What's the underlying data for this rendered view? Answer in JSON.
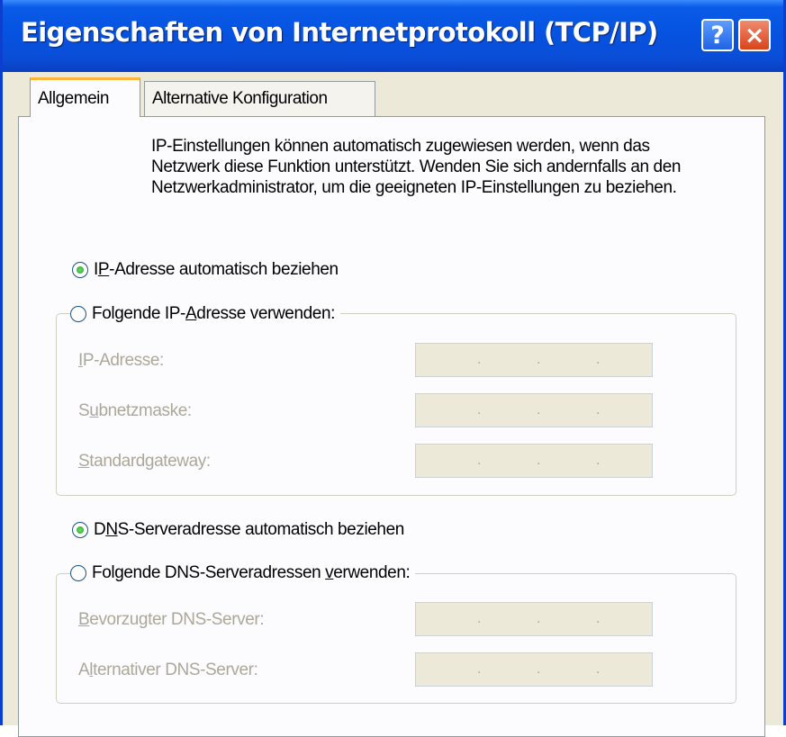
{
  "window": {
    "title": "Eigenschaften von Internetprotokoll (TCP/IP)",
    "help_label": "?",
    "close_label": "×"
  },
  "tabs": [
    {
      "label": "Allgemein",
      "active": true
    },
    {
      "label": "Alternative Konfiguration",
      "active": false
    }
  ],
  "description": "IP-Einstellungen können automatisch zugewiesen werden, wenn das Netzwerk diese Funktion unterstützt. Wenden Sie sich andernfalls an den Netzwerkadministrator, um die geeigneten IP-Einstellungen zu beziehen.",
  "ip": {
    "auto_option": {
      "mnemonic": "P",
      "pre": "I",
      "post": "-Adresse automatisch beziehen",
      "checked": true
    },
    "manual_option": {
      "pre": "Folgende IP-",
      "mnemonic": "A",
      "post": "dresse verwenden:",
      "checked": false
    },
    "fields": [
      {
        "pre": "",
        "mnemonic": "I",
        "post": "P-Adresse:"
      },
      {
        "pre": "S",
        "mnemonic": "u",
        "post": "bnetzmaske:"
      },
      {
        "pre": "",
        "mnemonic": "S",
        "post": "tandardgateway:"
      }
    ]
  },
  "dns": {
    "auto_option": {
      "pre": "D",
      "mnemonic": "N",
      "post": "S-Serveradresse automatisch beziehen",
      "checked": true
    },
    "manual_option": {
      "pre": "Folgende DNS-Serveradressen ",
      "mnemonic": "v",
      "post": "erwenden:",
      "checked": false
    },
    "fields": [
      {
        "pre": "",
        "mnemonic": "B",
        "post": "evorzugter DNS-Server:"
      },
      {
        "pre": "A",
        "mnemonic": "l",
        "post": "ternativer DNS-Server:"
      }
    ]
  },
  "ip_separator": "."
}
